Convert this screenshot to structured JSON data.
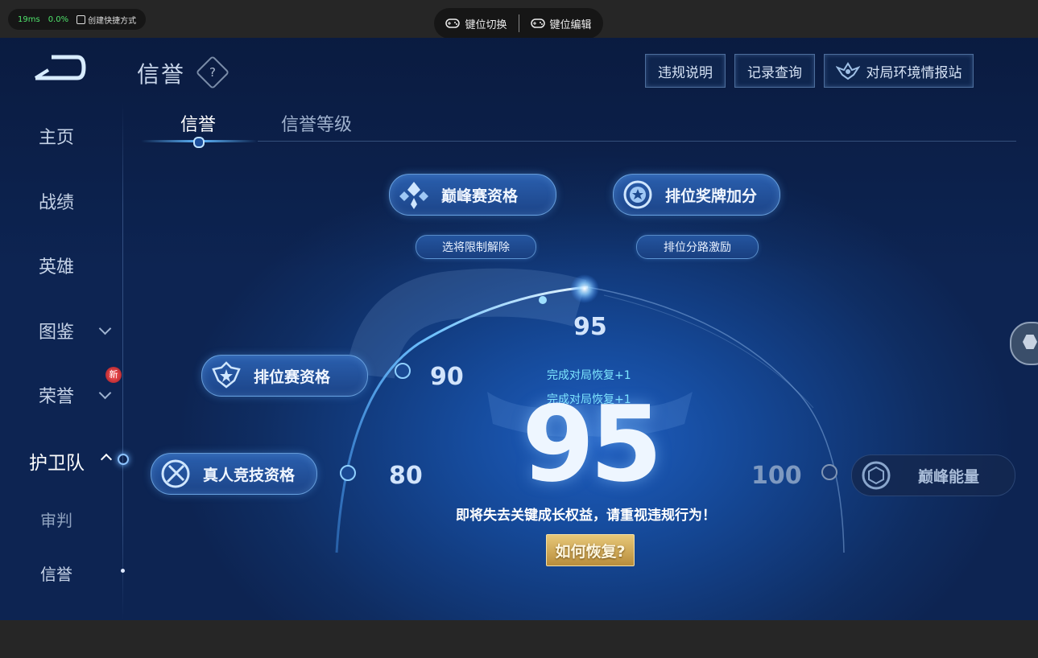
{
  "overlay": {
    "ping": "19ms",
    "loss": "0.0%",
    "shortcut_label": "创建快捷方式",
    "key_switch": "键位切换",
    "key_edit": "键位编辑"
  },
  "header": {
    "title": "信誉",
    "help": "?",
    "buttons": [
      "违规说明",
      "记录查询",
      "对局环境情报站"
    ]
  },
  "sidebar": {
    "items": [
      {
        "label": "主页"
      },
      {
        "label": "战绩"
      },
      {
        "label": "英雄"
      },
      {
        "label": "图鉴"
      },
      {
        "label": "荣誉"
      },
      {
        "label": "护卫队"
      },
      {
        "label": "审判"
      },
      {
        "label": "信誉"
      }
    ],
    "new_badge": "新"
  },
  "tabs": [
    "信誉",
    "信誉等级"
  ],
  "rewards": {
    "peak_qualification": "巅峰赛资格",
    "peak_sub": "选将限制解除",
    "rank_medal_bonus": "排位奖牌加分",
    "rank_sub": "排位分路激励",
    "rank_qualification": "排位赛资格",
    "pvp_qualification": "真人竞技资格",
    "peak_energy": "巅峰能量"
  },
  "scale": {
    "marks": [
      "80",
      "90",
      "95",
      "100"
    ]
  },
  "score": {
    "value": "95",
    "fraction": 0.95,
    "recovery_lines": [
      "完成对局恢复+1",
      "完成对局恢复+1"
    ],
    "warning": "即将失去关键成长权益，请重视违规行为！",
    "how_button": "如何恢复?"
  }
}
